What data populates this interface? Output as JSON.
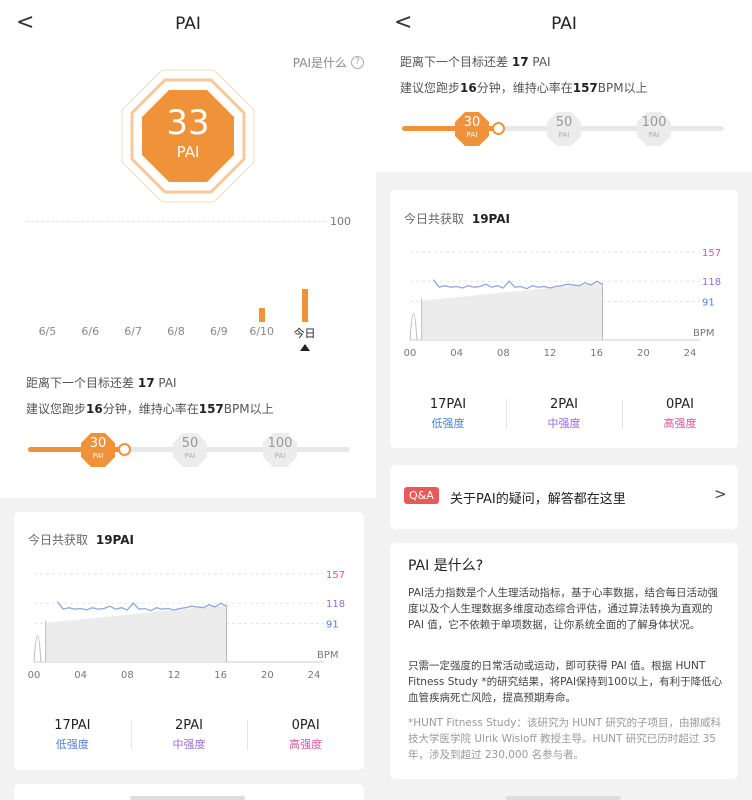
{
  "nav": {
    "back_glyph": "<",
    "title": "PAI"
  },
  "left": {
    "what_is_pai": "PAI是什么",
    "help_glyph": "?",
    "score_value": "33",
    "score_unit": "PAI",
    "bar_chart": {
      "ymax_label": "100",
      "categories": [
        "6/5",
        "6/6",
        "6/7",
        "6/8",
        "6/9",
        "6/10",
        "今日"
      ],
      "values": [
        0,
        0,
        0,
        0,
        0,
        14,
        33
      ],
      "selected": "今日"
    },
    "goal_prefix": "距离下一个目标还差",
    "goal_value": "17",
    "goal_unit": "PAI",
    "advice_a": "建议您跑步",
    "advice_minutes": "16",
    "advice_b": "分钟，维持心率在",
    "advice_bpm": "157",
    "advice_c": "BPM以上",
    "milestones": [
      {
        "value": "30",
        "unit": "PAI"
      },
      {
        "value": "50",
        "unit": "PAI"
      },
      {
        "value": "100",
        "unit": "PAI"
      }
    ],
    "today_label": "今日共获取",
    "today_value": "19PAI"
  },
  "right": {
    "goal_prefix": "距离下一个目标还差",
    "goal_value": "17",
    "goal_unit": "PAI",
    "advice_a": "建议您跑步",
    "advice_minutes": "16",
    "advice_b": "分钟，维持心率在",
    "advice_bpm": "157",
    "advice_c": "BPM以上",
    "milestones": [
      {
        "value": "30",
        "unit": "PAI"
      },
      {
        "value": "50",
        "unit": "PAI"
      },
      {
        "value": "100",
        "unit": "PAI"
      }
    ],
    "today_label": "今日共获取",
    "today_value": "19PAI",
    "qa_badge": "Q&A",
    "qa_text": "关于PAI的疑问，解答都在这里",
    "qa_arrow": ">",
    "about_title": "PAI 是什么?",
    "about_p1": "PAI活力指数是个人生理活动指标，基于心率数据，结合每日活动强度以及个人生理数据多维度动态综合评估，通过算法转换为直观的 PAI 值，它不依赖于单项数据，让你系统全面的了解身体状况。",
    "about_p2": "只需一定强度的日常活动或运动，即可获得 PAI 值。根据 HUNT Fitness Study *的研究结果，将PAI保持到100以上，有利于降低心血管疾病死亡风险，提高预期寿命。",
    "about_p3": "*HUNT Fitness Study：该研究为 HUNT 研究的子项目，由挪威科技大学医学院 Ulrik Wisloff 教授主导。HUNT 研究已历时超过 35 年，涉及到超过 230,000 名参与者。"
  },
  "hr_chart": {
    "type": "line",
    "y_labels": [
      "157",
      "118",
      "91"
    ],
    "y_unit": "BPM",
    "x_ticks": [
      "00",
      "04",
      "08",
      "12",
      "16",
      "20",
      "24"
    ],
    "xlim": [
      0,
      24
    ]
  },
  "levels": [
    {
      "value": "17PAI",
      "label": "低强度"
    },
    {
      "value": "2PAI",
      "label": "中强度"
    },
    {
      "value": "0PAI",
      "label": "高强度"
    }
  ],
  "colors": {
    "accent": "#f0923a",
    "hr_line": "#8fa7e0",
    "low": "#4d7fd6",
    "mid": "#9b6ad8",
    "high": "#e0509a",
    "qa_badge": "#e85a5a"
  },
  "chart_data": [
    {
      "type": "bar",
      "categories": [
        "6/5",
        "6/6",
        "6/7",
        "6/8",
        "6/9",
        "6/10",
        "今日"
      ],
      "values": [
        0,
        0,
        0,
        0,
        0,
        14,
        33
      ],
      "ylim": [
        0,
        100
      ],
      "title": "",
      "xlabel": "",
      "ylabel": ""
    },
    {
      "type": "line",
      "x": [
        0,
        0.25,
        0.5,
        1,
        1.5,
        2,
        2.5,
        3,
        3.5,
        4,
        4.5,
        5,
        5.5,
        6,
        6.5,
        7,
        7.5,
        8,
        8.5,
        9,
        9.5,
        10,
        10.5,
        11,
        11.5,
        12,
        12.5,
        13,
        13.5,
        14,
        14.5,
        15,
        15.5,
        16,
        16.5
      ],
      "y": [
        95,
        75,
        95,
        80,
        92,
        120,
        110,
        112,
        110,
        111,
        109,
        112,
        110,
        111,
        114,
        110,
        112,
        109,
        118,
        110,
        111,
        108,
        112,
        110,
        111,
        109,
        111,
        112,
        114,
        113,
        112,
        116,
        113,
        118,
        114
      ],
      "y_ticks": [
        157,
        118,
        91
      ],
      "xlim": [
        0,
        24
      ],
      "title": "",
      "xlabel": "",
      "ylabel": "BPM"
    }
  ]
}
